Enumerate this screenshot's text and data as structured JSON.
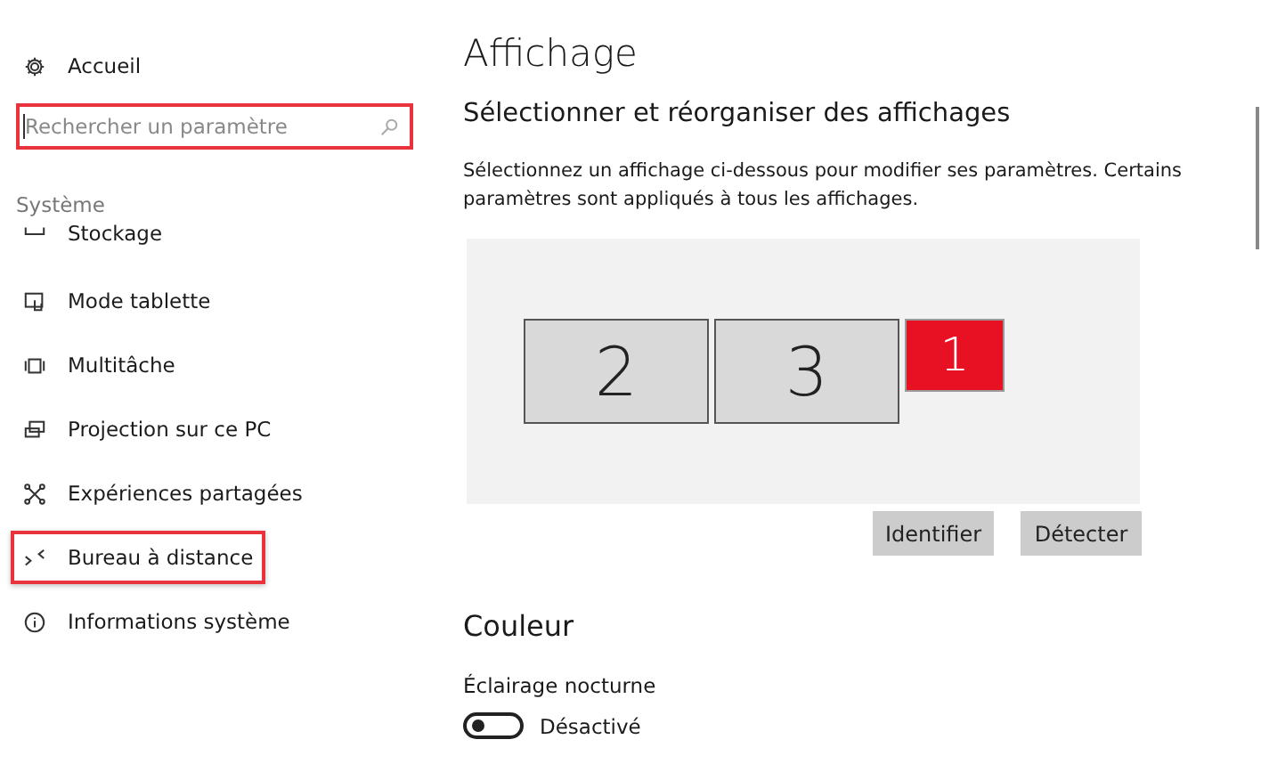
{
  "sidebar": {
    "home": {
      "label": "Accueil"
    },
    "search": {
      "placeholder": "Rechercher un paramètre",
      "highlighted": true
    },
    "section": "Système",
    "items": [
      {
        "label": "Stockage",
        "kind": "storage",
        "highlighted": false
      },
      {
        "label": "Mode tablette",
        "kind": "tablet",
        "highlighted": false
      },
      {
        "label": "Multitâche",
        "kind": "multitask",
        "highlighted": false
      },
      {
        "label": "Projection sur ce PC",
        "kind": "project",
        "highlighted": false
      },
      {
        "label": "Expériences partagées",
        "kind": "shared",
        "highlighted": false
      },
      {
        "label": "Bureau à distance",
        "kind": "remote",
        "highlighted": true
      },
      {
        "label": "Informations système",
        "kind": "info",
        "highlighted": false
      }
    ]
  },
  "main": {
    "title": "Affichage",
    "subtitle": "Sélectionner et réorganiser des affichages",
    "description": "Sélectionnez un affichage ci-dessous pour modifier ses paramètres. Certains paramètres sont appliqués à tous les affichages.",
    "monitors": [
      {
        "label": "2",
        "selected": false,
        "kind": "large"
      },
      {
        "label": "3",
        "selected": false,
        "kind": "large"
      },
      {
        "label": "1",
        "selected": true,
        "kind": "small"
      }
    ],
    "buttons": [
      "Identifier",
      "Détecter"
    ],
    "color_section": {
      "title": "Couleur",
      "setting": "Éclairage nocturne",
      "toggle": {
        "on": false,
        "label": "Désactivé"
      }
    }
  }
}
